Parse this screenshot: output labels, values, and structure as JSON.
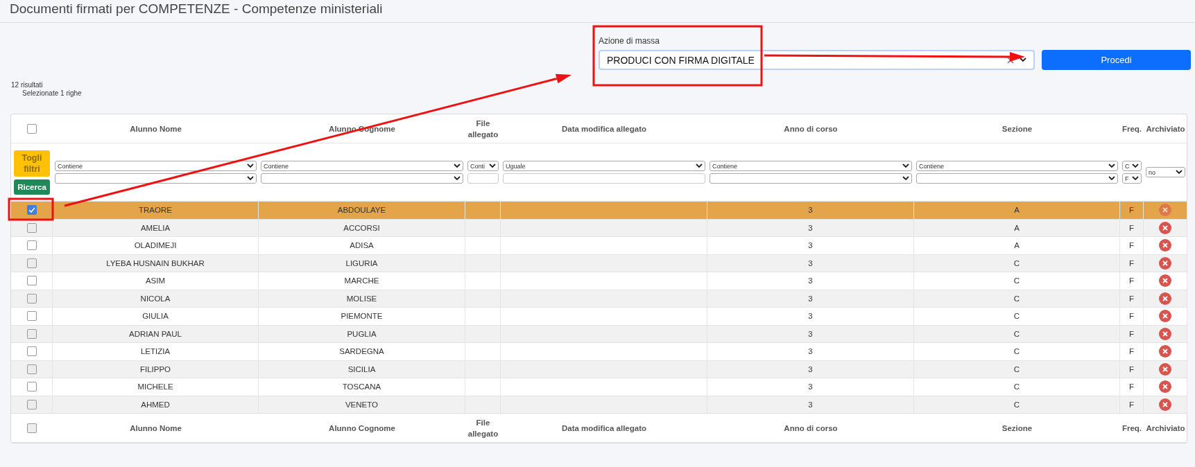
{
  "page": {
    "title": "Documenti firmati per COMPETENZE - Competenze ministeriali"
  },
  "mass_action": {
    "label": "Azione di massa",
    "value": "PRODUCI CON FIRMA DIGITALE",
    "button": "Procedi"
  },
  "results": {
    "count": "12 risultati",
    "selected": "Selezionate 1 righe"
  },
  "table": {
    "select_all_checked": false,
    "columns": [
      "Alunno Nome",
      "Alunno Cognome",
      "File allegato",
      "Data modifica allegato",
      "Anno di corso",
      "Sezione",
      "Freq.",
      "Archiviato"
    ],
    "filter_buttons": [
      {
        "kind": "clear",
        "label": "Togli filtri"
      },
      {
        "kind": "search",
        "label": "Ricerca"
      }
    ],
    "filters": [
      {
        "kind": "select-select",
        "operator": "Contiene"
      },
      {
        "kind": "select-select",
        "operator": "Contiene"
      },
      {
        "kind": "select-input",
        "operator": "Conti"
      },
      {
        "kind": "select-input",
        "operator": "Uguale"
      },
      {
        "kind": "select-select",
        "operator": "Contiene"
      },
      {
        "kind": "select-select",
        "operator": "Contiene"
      },
      {
        "kind": "select-select",
        "operator": "C",
        "value": "F"
      },
      {
        "kind": "select",
        "value": "no"
      }
    ],
    "rows": [
      {
        "selected": true,
        "nome": "TRAORE",
        "cognome": "ABDOULAYE",
        "anno": "3",
        "sezione": "A",
        "freq": "F"
      },
      {
        "selected": false,
        "nome": "AMELIA",
        "cognome": "ACCORSI",
        "anno": "3",
        "sezione": "A",
        "freq": "F"
      },
      {
        "selected": false,
        "nome": "OLADIMEJI",
        "cognome": "ADISA",
        "anno": "3",
        "sezione": "A",
        "freq": "F"
      },
      {
        "selected": false,
        "nome": "LYEBA HUSNAIN BUKHAR",
        "cognome": "LIGURIA",
        "anno": "3",
        "sezione": "C",
        "freq": "F"
      },
      {
        "selected": false,
        "nome": "ASIM",
        "cognome": "MARCHE",
        "anno": "3",
        "sezione": "C",
        "freq": "F"
      },
      {
        "selected": false,
        "nome": "NICOLA",
        "cognome": "MOLISE",
        "anno": "3",
        "sezione": "C",
        "freq": "F"
      },
      {
        "selected": false,
        "nome": "GIULIA",
        "cognome": "PIEMONTE",
        "anno": "3",
        "sezione": "C",
        "freq": "F"
      },
      {
        "selected": false,
        "nome": "ADRIAN PAUL",
        "cognome": "PUGLIA",
        "anno": "3",
        "sezione": "C",
        "freq": "F"
      },
      {
        "selected": false,
        "nome": "LETIZIA",
        "cognome": "SARDEGNA",
        "anno": "3",
        "sezione": "C",
        "freq": "F"
      },
      {
        "selected": false,
        "nome": "FILIPPO",
        "cognome": "SICILIA",
        "anno": "3",
        "sezione": "C",
        "freq": "F"
      },
      {
        "selected": false,
        "nome": "MICHELE",
        "cognome": "TOSCANA",
        "anno": "3",
        "sezione": "C",
        "freq": "F"
      },
      {
        "selected": false,
        "nome": "AHMED",
        "cognome": "VENETO",
        "anno": "3",
        "sezione": "C",
        "freq": "F"
      }
    ],
    "footer_select_all_checked": false,
    "footer_columns": [
      "Alunno Nome",
      "Alunno Cognome",
      "File allegato",
      "Data modifica allegato",
      "Anno di corso",
      "Sezione",
      "Freq.",
      "Archiviato"
    ]
  },
  "annotations": [
    {
      "kind": "box"
    },
    {
      "kind": "box"
    },
    {
      "kind": "arrow"
    },
    {
      "kind": "arrow"
    }
  ]
}
